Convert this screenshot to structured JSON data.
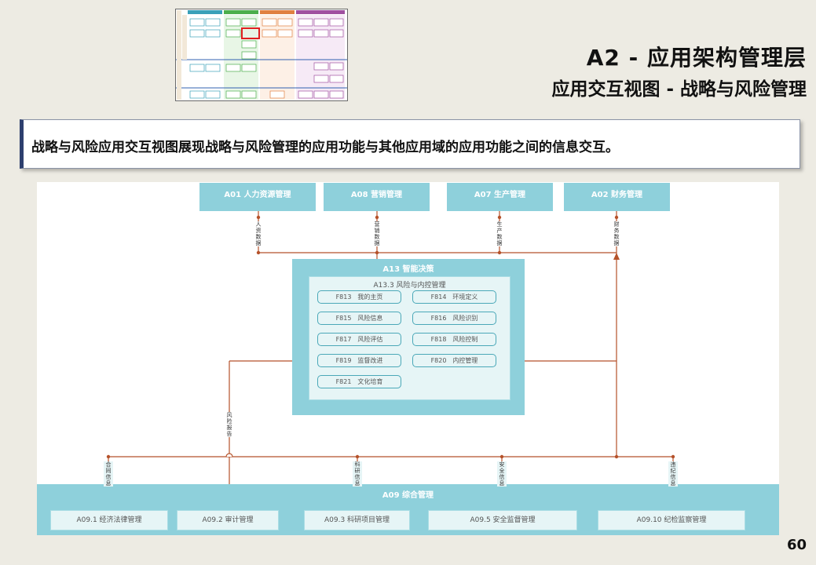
{
  "header": {
    "title": "A2 - 应用架构管理层",
    "subtitle": "应用交互视图 - 战略与风险管理"
  },
  "intro": "战略与风险应用交互视图展现战略与风险管理的应用功能与其他应用域的应用功能之间的信息交互。",
  "page_number": "60",
  "colors": {
    "background": "#edebe3",
    "teal_box": "#8ed0db",
    "inner_box": "#e6f5f6",
    "connector": "#b5522a",
    "highlight": "#e02020"
  },
  "diagram": {
    "top_domains": [
      "A01 人力资源管理",
      "A08 营销管理",
      "A07 生产管理",
      "A02 财务管理"
    ],
    "top_flows": [
      "人资数据",
      "营销数据",
      "生产数据",
      "财务数据"
    ],
    "a13_title": "A13 智能决策",
    "a133_title": "A13.3 风险与内控管理",
    "functions": [
      "F813　我的主页",
      "F814　环境定义",
      "F815　风险信息",
      "F816　风险识别",
      "F817　风险评估",
      "F818　风险控制",
      "F819　监督改进",
      "F820　内控管理",
      "F821　文化培育"
    ],
    "risk_report_label": "风险报告",
    "bottom_flows": [
      "合同信息",
      "科研信息",
      "安全信息",
      "违纪信息"
    ],
    "a09_title": "A09 综合管理",
    "a09_subs": [
      "A09.1 经济法律管理",
      "A09.2 审计管理",
      "A09.3 科研项目管理",
      "A09.5 安全监督管理",
      "A09.10 纪检监察管理"
    ]
  }
}
